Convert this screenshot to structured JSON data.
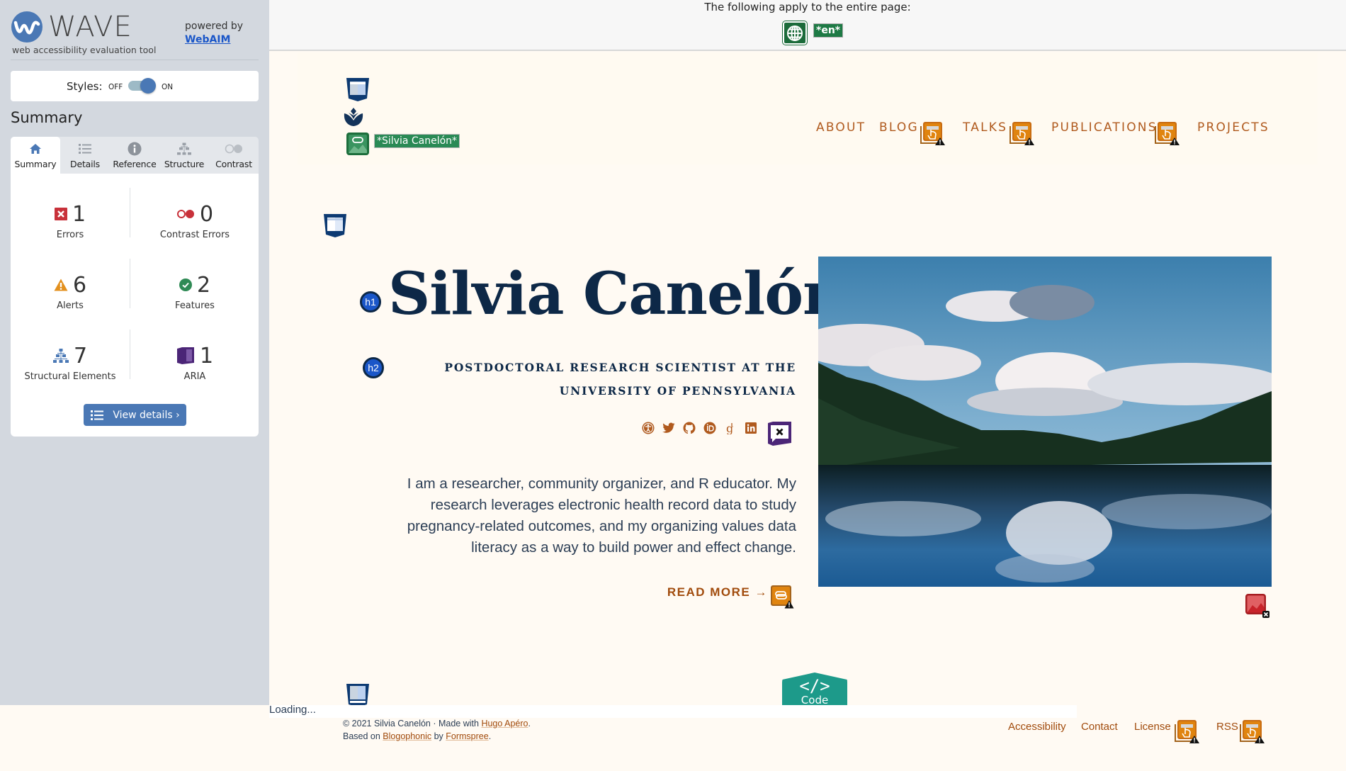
{
  "wave": {
    "brand": "WAVE",
    "tagline": "web accessibility evaluation tool",
    "powered_by": "powered by",
    "webaim_link": "WebAIM",
    "styles_label": "Styles:",
    "styles_off": "OFF",
    "styles_on": "ON",
    "styles_enabled": true,
    "summary_title": "Summary",
    "tabs": [
      {
        "label": "Summary",
        "icon": "home-icon",
        "active": true
      },
      {
        "label": "Details",
        "icon": "list-icon",
        "active": false
      },
      {
        "label": "Reference",
        "icon": "info-icon",
        "active": false
      },
      {
        "label": "Structure",
        "icon": "hierarchy-icon",
        "active": false
      },
      {
        "label": "Contrast",
        "icon": "contrast-icon",
        "active": false
      }
    ],
    "stats": [
      {
        "label": "Errors",
        "count": "1",
        "icon": "error-icon",
        "color": "#c8313a"
      },
      {
        "label": "Contrast Errors",
        "count": "0",
        "icon": "contrast-error-icon",
        "color": "#c8313a"
      },
      {
        "label": "Alerts",
        "count": "6",
        "icon": "alert-icon",
        "color": "#e3901e"
      },
      {
        "label": "Features",
        "count": "2",
        "icon": "feature-icon",
        "color": "#2f8a55"
      },
      {
        "label": "Structural Elements",
        "count": "7",
        "icon": "structure-icon",
        "color": "#4a78b5"
      },
      {
        "label": "ARIA",
        "count": "1",
        "icon": "aria-icon",
        "color": "#4b2577"
      }
    ],
    "view_details": "View details ›",
    "accent": "#4a78b5"
  },
  "topstrip": {
    "text": "The following apply to the entire page:",
    "lang_label": "*en*"
  },
  "site": {
    "logo_alt_label": "*Silvia Canelón*",
    "nav": [
      {
        "label": "ABOUT",
        "alert": false
      },
      {
        "label": "BLOG",
        "alert": true
      },
      {
        "label": "TALKS",
        "alert": true
      },
      {
        "label": "PUBLICATIONS",
        "alert": true
      },
      {
        "label": "PROJECTS",
        "alert": false
      }
    ],
    "h1_badge": "h1",
    "h2_badge": "h2",
    "title": "Silvia Canelón",
    "subtitle": "POSTDOCTORAL RESEARCH SCIENTIST AT THE UNIVERSITY OF PENNSYLVANIA",
    "socials": [
      "accessibility-icon",
      "twitter-icon",
      "github-icon",
      "orcid-icon",
      "google-scholar-icon",
      "linkedin-icon"
    ],
    "bio": "I am a researcher, community organizer, and R educator. My research leverages electronic health record data to study pregnancy-related outcomes, and my organizing values data literacy as a way to build power and effect change.",
    "read_more": "READ MORE →",
    "code_badge_glyph": "</>",
    "code_badge_label": "Code",
    "brand_color": "#b05a1e",
    "heading_color": "#0d2847"
  },
  "footer": {
    "loading": "Loading...",
    "copyright": "© 2021 Silvia Canelón",
    "sep": " · ",
    "made_with": "Made with ",
    "hugo_link": "Hugo Apéro",
    "based_on": "Based on ",
    "blogophonic_link": "Blogophonic",
    "by": " by ",
    "formspree_link": "Formspree",
    "period": ".",
    "nav": [
      {
        "label": "Accessibility",
        "alert": false
      },
      {
        "label": "Contact",
        "alert": false
      },
      {
        "label": "License",
        "alert": true
      },
      {
        "label": "RSS",
        "alert": true
      }
    ]
  }
}
